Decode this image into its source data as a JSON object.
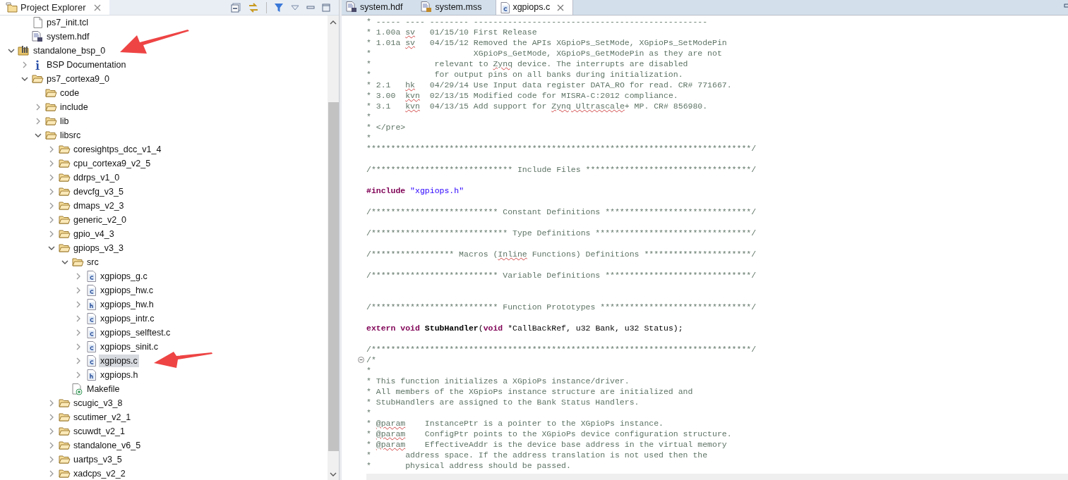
{
  "explorer": {
    "title": "Project Explorer",
    "tree": [
      {
        "kind": "hidden-parent",
        "children": [
          {
            "label": "ps7_init.tcl",
            "kind": "text-file",
            "selected": false
          },
          {
            "label": "system.hdf",
            "kind": "hdf-file",
            "selected": false
          }
        ]
      },
      {
        "label": "standalone_bsp_0",
        "kind": "bsp-project",
        "expanded": true,
        "selected": false,
        "children": [
          {
            "label": "BSP Documentation",
            "kind": "info",
            "expanded": false,
            "selected": false
          },
          {
            "label": "ps7_cortexa9_0",
            "kind": "folder",
            "expanded": true,
            "selected": false,
            "children": [
              {
                "label": "code",
                "kind": "folder",
                "selected": false
              },
              {
                "label": "include",
                "kind": "folder",
                "expanded": false,
                "selected": false
              },
              {
                "label": "lib",
                "kind": "folder",
                "expanded": false,
                "selected": false
              },
              {
                "label": "libsrc",
                "kind": "folder",
                "expanded": true,
                "selected": false,
                "children": [
                  {
                    "label": "coresightps_dcc_v1_4",
                    "kind": "folder",
                    "expanded": false,
                    "selected": false
                  },
                  {
                    "label": "cpu_cortexa9_v2_5",
                    "kind": "folder",
                    "expanded": false,
                    "selected": false
                  },
                  {
                    "label": "ddrps_v1_0",
                    "kind": "folder",
                    "expanded": false,
                    "selected": false
                  },
                  {
                    "label": "devcfg_v3_5",
                    "kind": "folder",
                    "expanded": false,
                    "selected": false
                  },
                  {
                    "label": "dmaps_v2_3",
                    "kind": "folder",
                    "expanded": false,
                    "selected": false
                  },
                  {
                    "label": "generic_v2_0",
                    "kind": "folder",
                    "expanded": false,
                    "selected": false
                  },
                  {
                    "label": "gpio_v4_3",
                    "kind": "folder",
                    "expanded": false,
                    "selected": false
                  },
                  {
                    "label": "gpiops_v3_3",
                    "kind": "folder",
                    "expanded": true,
                    "selected": false,
                    "children": [
                      {
                        "label": "src",
                        "kind": "folder",
                        "expanded": true,
                        "selected": false,
                        "children": [
                          {
                            "label": "xgpiops_g.c",
                            "kind": "c-file",
                            "expanded": false,
                            "selected": false
                          },
                          {
                            "label": "xgpiops_hw.c",
                            "kind": "c-file",
                            "expanded": false,
                            "selected": false
                          },
                          {
                            "label": "xgpiops_hw.h",
                            "kind": "h-file",
                            "expanded": false,
                            "selected": false
                          },
                          {
                            "label": "xgpiops_intr.c",
                            "kind": "c-file",
                            "expanded": false,
                            "selected": false
                          },
                          {
                            "label": "xgpiops_selftest.c",
                            "kind": "c-file",
                            "expanded": false,
                            "selected": false
                          },
                          {
                            "label": "xgpiops_sinit.c",
                            "kind": "c-file",
                            "expanded": false,
                            "selected": false
                          },
                          {
                            "label": "xgpiops.c",
                            "kind": "c-file",
                            "expanded": false,
                            "selected": true
                          },
                          {
                            "label": "xgpiops.h",
                            "kind": "h-file",
                            "expanded": false,
                            "selected": false
                          }
                        ]
                      },
                      {
                        "label": "Makefile",
                        "kind": "makefile",
                        "selected": false
                      }
                    ]
                  },
                  {
                    "label": "scugic_v3_8",
                    "kind": "folder",
                    "expanded": false,
                    "selected": false
                  },
                  {
                    "label": "scutimer_v2_1",
                    "kind": "folder",
                    "expanded": false,
                    "selected": false
                  },
                  {
                    "label": "scuwdt_v2_1",
                    "kind": "folder",
                    "expanded": false,
                    "selected": false
                  },
                  {
                    "label": "standalone_v6_5",
                    "kind": "folder",
                    "expanded": false,
                    "selected": false
                  },
                  {
                    "label": "uartps_v3_5",
                    "kind": "folder",
                    "expanded": false,
                    "selected": false
                  },
                  {
                    "label": "xadcps_v2_2",
                    "kind": "folder",
                    "expanded": false,
                    "selected": false
                  }
                ]
              }
            ]
          }
        ]
      }
    ]
  },
  "editor": {
    "tabs": [
      {
        "label": "system.hdf",
        "kind": "hdf-file",
        "selected": false
      },
      {
        "label": "system.mss",
        "kind": "mss-file",
        "selected": false
      },
      {
        "label": "xgpiops.c",
        "kind": "c-file",
        "selected": true,
        "closable": true
      }
    ],
    "lines": [
      {
        "kind": "code",
        "segments": [
          {
            "kind": "comment",
            "text": "* ----- ---- -------- ------------------------------------------------"
          }
        ]
      },
      {
        "kind": "code",
        "segments": [
          {
            "kind": "comment",
            "text": "* 1.00a "
          },
          {
            "kind": "misspelled",
            "text": "sv"
          },
          {
            "kind": "comment",
            "text": "   01/15/10 First Release"
          }
        ]
      },
      {
        "kind": "code",
        "segments": [
          {
            "kind": "comment",
            "text": "* 1.01a "
          },
          {
            "kind": "misspelled",
            "text": "sv"
          },
          {
            "kind": "comment",
            "text": "   04/15/12 Removed the APIs XGpioPs_SetMode, XGpioPs_SetModePin"
          }
        ]
      },
      {
        "kind": "code",
        "segments": [
          {
            "kind": "comment",
            "text": "*                     XGpioPs_GetMode, XGpioPs_GetModePin as they are not"
          }
        ]
      },
      {
        "kind": "code",
        "segments": [
          {
            "kind": "comment",
            "text": "*             relevant to "
          },
          {
            "kind": "misspelled",
            "text": "Zynq"
          },
          {
            "kind": "comment",
            "text": " device. The interrupts are disabled"
          }
        ]
      },
      {
        "kind": "code",
        "segments": [
          {
            "kind": "comment",
            "text": "*             for output pins on all banks during initialization."
          }
        ]
      },
      {
        "kind": "code",
        "segments": [
          {
            "kind": "comment",
            "text": "* 2.1   "
          },
          {
            "kind": "misspelled",
            "text": "hk"
          },
          {
            "kind": "comment",
            "text": "   04/29/14 Use Input data register DATA_RO for read. CR# 771667."
          }
        ]
      },
      {
        "kind": "code",
        "segments": [
          {
            "kind": "comment",
            "text": "* 3.00  "
          },
          {
            "kind": "misspelled",
            "text": "kvn"
          },
          {
            "kind": "comment",
            "text": "  02/13/15 Modified code for MISRA-C:2012 compliance."
          }
        ]
      },
      {
        "kind": "code",
        "segments": [
          {
            "kind": "comment",
            "text": "* 3.1   "
          },
          {
            "kind": "misspelled",
            "text": "kvn"
          },
          {
            "kind": "comment",
            "text": "  04/13/15 Add support for "
          },
          {
            "kind": "misspelled",
            "text": "Zynq Ultrascale"
          },
          {
            "kind": "comment",
            "text": "+ MP. CR# 856980."
          }
        ]
      },
      {
        "kind": "code",
        "segments": [
          {
            "kind": "comment",
            "text": "*"
          }
        ]
      },
      {
        "kind": "code",
        "segments": [
          {
            "kind": "comment",
            "text": "* </pre>"
          }
        ]
      },
      {
        "kind": "code",
        "segments": [
          {
            "kind": "comment",
            "text": "*"
          }
        ]
      },
      {
        "kind": "code",
        "segments": [
          {
            "kind": "comment",
            "text": "*******************************************************************************/"
          }
        ]
      },
      {
        "kind": "blank"
      },
      {
        "kind": "code",
        "segments": [
          {
            "kind": "comment",
            "text": "/***************************** Include Files **********************************/"
          }
        ]
      },
      {
        "kind": "blank"
      },
      {
        "kind": "code",
        "segments": [
          {
            "kind": "keyword",
            "text": "#include"
          },
          {
            "kind": "string",
            "text": " \"xgpiops.h\""
          }
        ]
      },
      {
        "kind": "blank"
      },
      {
        "kind": "code",
        "segments": [
          {
            "kind": "comment",
            "text": "/************************** Constant Definitions ******************************/"
          }
        ]
      },
      {
        "kind": "blank"
      },
      {
        "kind": "code",
        "segments": [
          {
            "kind": "comment",
            "text": "/**************************** Type Definitions ********************************/"
          }
        ]
      },
      {
        "kind": "blank"
      },
      {
        "kind": "code",
        "segments": [
          {
            "kind": "comment",
            "text": "/***************** Macros ("
          },
          {
            "kind": "misspelled",
            "text": "Inline"
          },
          {
            "kind": "comment",
            "text": " Functions) Definitions **********************/"
          }
        ]
      },
      {
        "kind": "blank"
      },
      {
        "kind": "code",
        "segments": [
          {
            "kind": "comment",
            "text": "/************************** Variable Definitions ******************************/"
          }
        ]
      },
      {
        "kind": "blank"
      },
      {
        "kind": "blank"
      },
      {
        "kind": "code",
        "segments": [
          {
            "kind": "comment",
            "text": "/************************** Function Prototypes *******************************/"
          }
        ]
      },
      {
        "kind": "blank"
      },
      {
        "kind": "code",
        "segments": [
          {
            "kind": "keyword",
            "text": "extern void"
          },
          {
            "kind": "function",
            "text": " StubHandler"
          },
          {
            "kind": "plain",
            "text": "("
          },
          {
            "kind": "keyword",
            "text": "void"
          },
          {
            "kind": "plain",
            "text": " *CallBackRef, u32 Bank, u32 Status);"
          }
        ]
      },
      {
        "kind": "blank"
      },
      {
        "kind": "code",
        "segments": [
          {
            "kind": "comment",
            "text": "/******************************************************************************/"
          }
        ]
      },
      {
        "kind": "code",
        "folded": false,
        "segments": [
          {
            "kind": "comment",
            "text": "/*"
          }
        ]
      },
      {
        "kind": "code",
        "segments": [
          {
            "kind": "comment",
            "text": "*"
          }
        ]
      },
      {
        "kind": "code",
        "segments": [
          {
            "kind": "comment",
            "text": "* This function initializes a XGpioPs instance/driver."
          }
        ]
      },
      {
        "kind": "code",
        "segments": [
          {
            "kind": "comment",
            "text": "* All members of the XGpioPs instance structure are initialized and"
          }
        ]
      },
      {
        "kind": "code",
        "segments": [
          {
            "kind": "comment",
            "text": "* StubHandlers are assigned to the Bank Status Handlers."
          }
        ]
      },
      {
        "kind": "code",
        "segments": [
          {
            "kind": "comment",
            "text": "*"
          }
        ]
      },
      {
        "kind": "code",
        "segments": [
          {
            "kind": "comment",
            "text": "* "
          },
          {
            "kind": "misspelled",
            "text": "@param"
          },
          {
            "kind": "comment",
            "text": "    InstancePtr is a pointer to the XGpioPs instance."
          }
        ]
      },
      {
        "kind": "code",
        "segments": [
          {
            "kind": "comment",
            "text": "* "
          },
          {
            "kind": "misspelled",
            "text": "@param"
          },
          {
            "kind": "comment",
            "text": "    ConfigPtr points to the XGpioPs device configuration structure."
          }
        ]
      },
      {
        "kind": "code",
        "segments": [
          {
            "kind": "comment",
            "text": "* "
          },
          {
            "kind": "misspelled",
            "text": "@param"
          },
          {
            "kind": "comment",
            "text": "    EffectiveAddr is the device base address in the virtual memory"
          }
        ]
      },
      {
        "kind": "code",
        "segments": [
          {
            "kind": "comment",
            "text": "*       address space. If the address translation is not used then the"
          }
        ]
      },
      {
        "kind": "code",
        "segments": [
          {
            "kind": "comment",
            "text": "*       physical address should be passed."
          }
        ]
      }
    ]
  }
}
